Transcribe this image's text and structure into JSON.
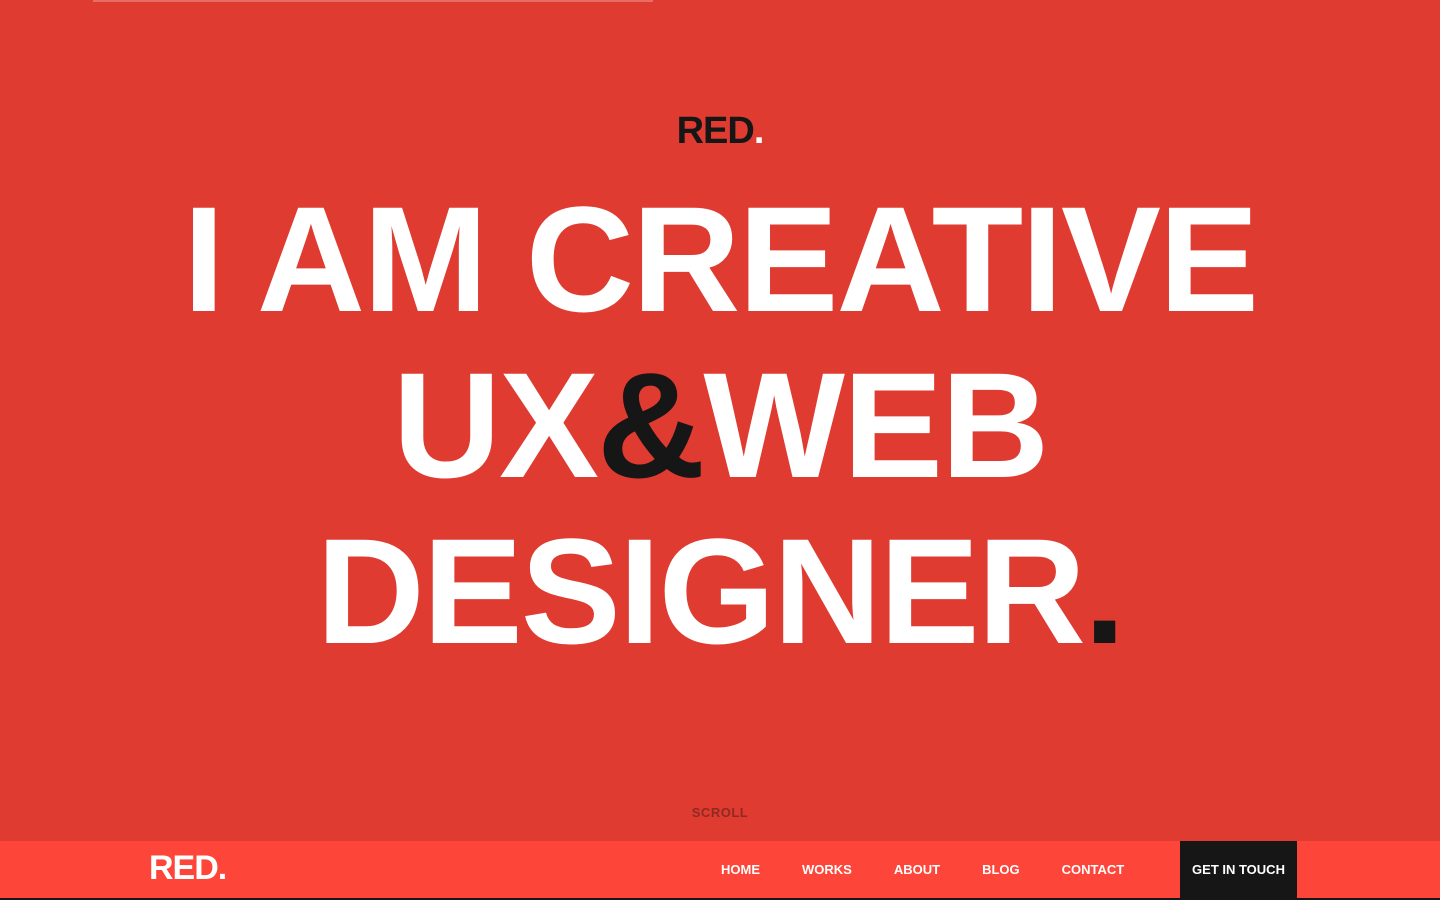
{
  "hero": {
    "logo_text": "RED",
    "logo_dot": ".",
    "headline_line1": "I AM CREATIVE",
    "headline_line2_part1": "UX",
    "headline_line2_amp": "&",
    "headline_line2_part2": "WEB",
    "headline_line3_text": "DESIGNER",
    "headline_line3_dot": ".",
    "scroll_label": "SCROLL"
  },
  "navbar": {
    "logo_text": "RED",
    "logo_dot": ".",
    "links": [
      {
        "label": "HOME"
      },
      {
        "label": "WORKS"
      },
      {
        "label": "ABOUT"
      },
      {
        "label": "BLOG"
      },
      {
        "label": "CONTACT"
      }
    ],
    "cta_label": "GET IN TOUCH"
  },
  "colors": {
    "background": "#df3b31",
    "navbar": "#fe4539",
    "dark": "#161616",
    "light": "#ffffff"
  }
}
